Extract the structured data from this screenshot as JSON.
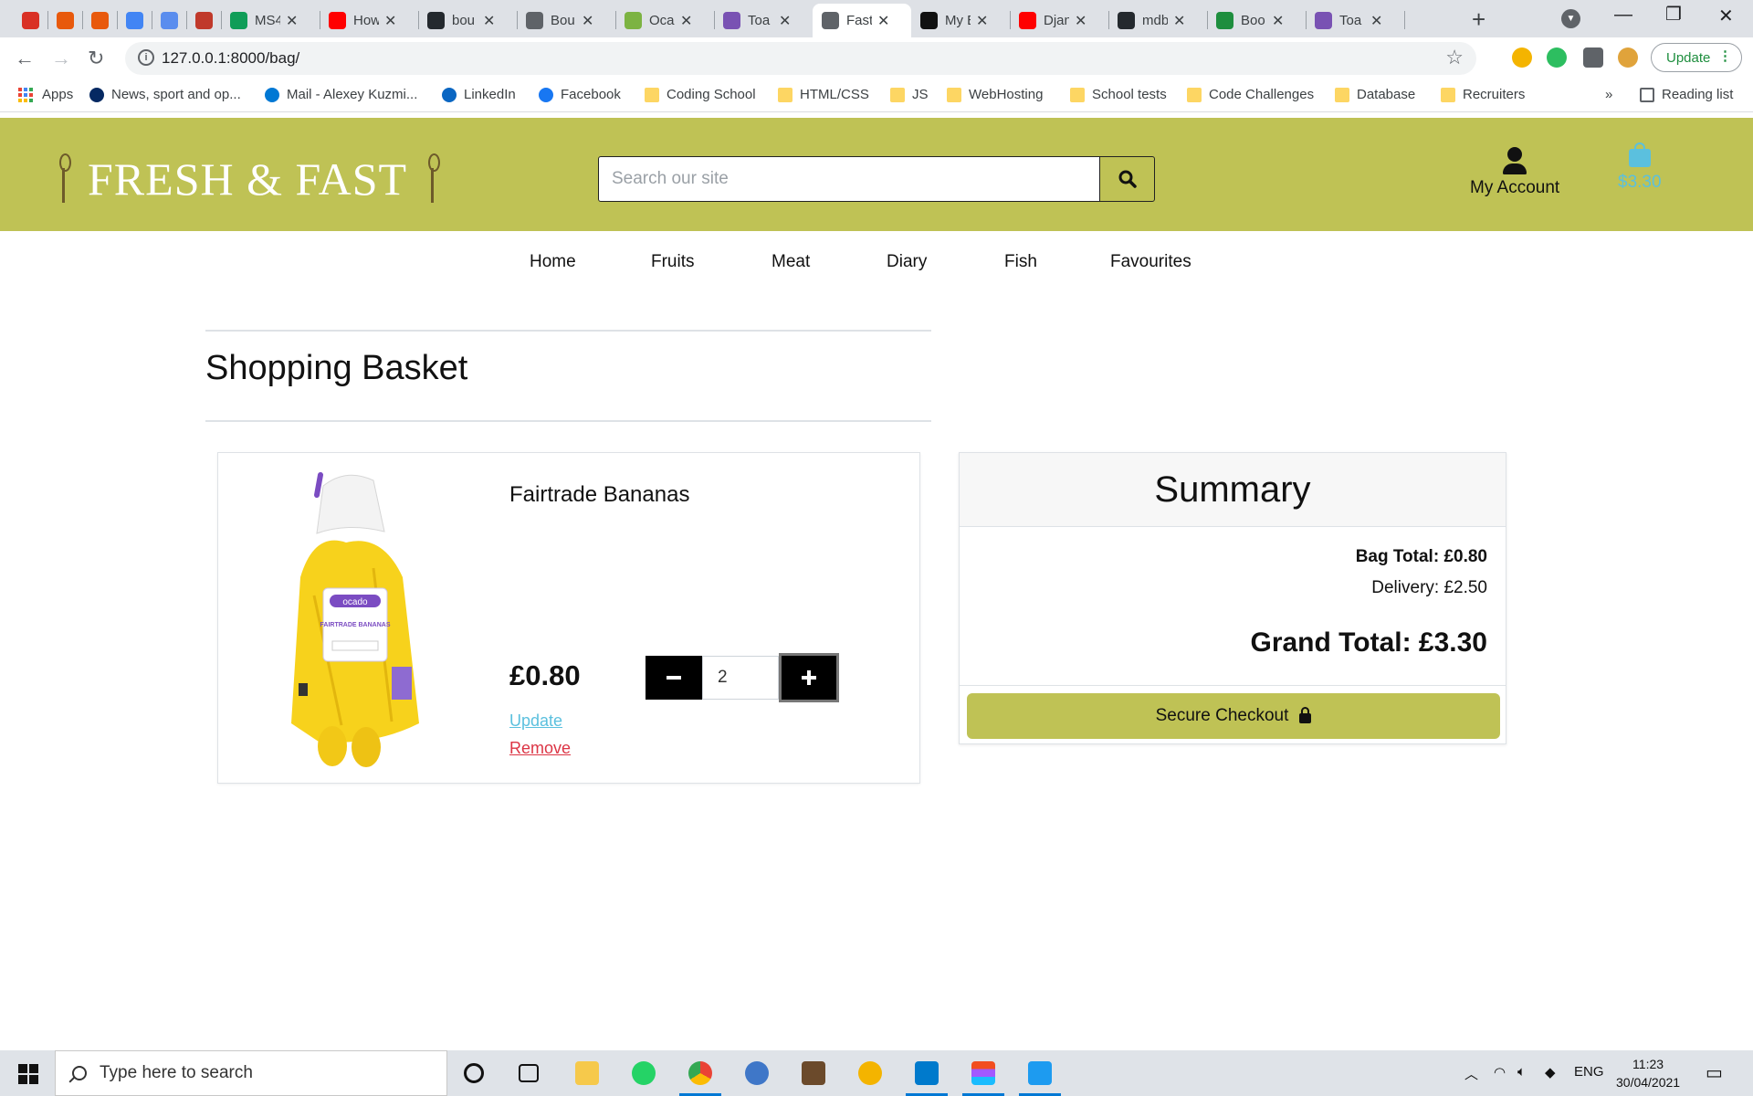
{
  "browser": {
    "tabs": [
      {
        "label": "",
        "icon": "u-app-icon",
        "color": "#d93025"
      },
      {
        "label": "",
        "icon": "opera-icon",
        "color": "#e8590c"
      },
      {
        "label": "",
        "icon": "opera-icon",
        "color": "#e8590c"
      },
      {
        "label": "",
        "icon": "docs-icon",
        "color": "#4285f4"
      },
      {
        "label": "",
        "icon": "cloud-icon",
        "color": "#5a8dee"
      },
      {
        "label": "",
        "icon": "shield-icon",
        "color": "#c0392b"
      },
      {
        "label": "MS4",
        "icon": "sheets-icon",
        "color": "#0f9d58"
      },
      {
        "label": "How",
        "icon": "youtube-icon",
        "color": "#ff0000"
      },
      {
        "label": "bou",
        "icon": "github-icon",
        "color": "#24292e"
      },
      {
        "label": "Bou",
        "icon": "globe-icon",
        "color": "#5f6368"
      },
      {
        "label": "Oca",
        "icon": "z-icon",
        "color": "#7cb342"
      },
      {
        "label": "Toa",
        "icon": "bootstrap-icon",
        "color": "#7952b3"
      },
      {
        "label": "Fast",
        "icon": "globe-icon",
        "color": "#5f6368",
        "active": true
      },
      {
        "label": "My E",
        "icon": "mks-icon",
        "color": "#111111"
      },
      {
        "label": "Djan",
        "icon": "youtube-icon",
        "color": "#ff0000"
      },
      {
        "label": "mdb",
        "icon": "github-icon",
        "color": "#24292e"
      },
      {
        "label": "Boo",
        "icon": "w-icon",
        "color": "#1e8e3e"
      },
      {
        "label": "Toa",
        "icon": "bootstrap-icon",
        "color": "#7952b3"
      }
    ],
    "url": "127.0.0.1:8000/bag/",
    "update_label": "Update",
    "bookmarks": {
      "apps": "Apps",
      "items": [
        {
          "label": "News, sport and op...",
          "icon": "guardian-icon"
        },
        {
          "label": "Mail - Alexey Kuzmi...",
          "icon": "outlook-icon"
        },
        {
          "label": "LinkedIn",
          "icon": "linkedin-icon"
        },
        {
          "label": "Facebook",
          "icon": "facebook-icon"
        },
        {
          "label": "Coding School",
          "icon": "folder-icon"
        },
        {
          "label": "HTML/CSS",
          "icon": "folder-icon"
        },
        {
          "label": "JS",
          "icon": "folder-icon"
        },
        {
          "label": "WebHosting",
          "icon": "folder-icon"
        },
        {
          "label": "School tests",
          "icon": "folder-icon"
        },
        {
          "label": "Code Challenges",
          "icon": "folder-icon"
        },
        {
          "label": "Database",
          "icon": "folder-icon"
        },
        {
          "label": "Recruiters",
          "icon": "folder-icon"
        }
      ],
      "overflow": "»",
      "reading_list": "Reading list"
    }
  },
  "site": {
    "brand": "FRESH & FAST",
    "brand_color": "#bfc255",
    "search_placeholder": "Search our site",
    "account_label": "My Account",
    "bag_total": "$3.30",
    "bag_color": "#5bc0de",
    "nav": [
      "Home",
      "Fruits",
      "Meat",
      "Diary",
      "Fish",
      "Favourites"
    ]
  },
  "basket": {
    "title": "Shopping Basket",
    "item": {
      "name": "Fairtrade Bananas",
      "price": "£0.80",
      "quantity": "2",
      "update_label": "Update",
      "remove_label": "Remove",
      "pack_brand": "ocado",
      "pack_label": "FAIRTRADE BANANAS"
    }
  },
  "summary": {
    "title": "Summary",
    "bag_total": "Bag Total: £0.80",
    "delivery": "Delivery: £2.50",
    "grand_total": "Grand Total: £3.30",
    "checkout_label": "Secure Checkout"
  },
  "taskbar": {
    "search_placeholder": "Type here to search",
    "language": "ENG",
    "time": "11:23",
    "date": "30/04/2021"
  }
}
